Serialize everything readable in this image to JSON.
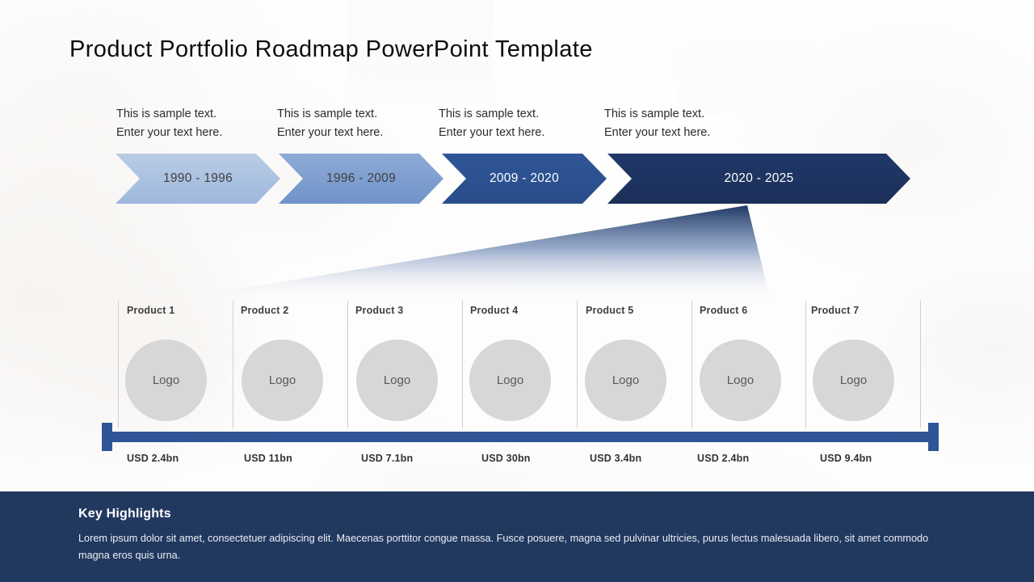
{
  "slide": {
    "title": "Product Portfolio Roadmap PowerPoint Template",
    "background_color": "#ffffff"
  },
  "timeline": {
    "phases": [
      {
        "caption_line1": "This is sample text.",
        "caption_line2": "Enter your text here.",
        "period": "1990 - 1996",
        "fill": "#a8bfdf",
        "text_color": "#3f3f3f"
      },
      {
        "caption_line1": "This is sample text.",
        "caption_line2": "Enter your text here.",
        "period": "1996 - 2009",
        "fill": "#7e9ece",
        "text_color": "#3f3f3f"
      },
      {
        "caption_line1": "This is sample text.",
        "caption_line2": "Enter your text here.",
        "period": "2009 - 2020",
        "fill": "#2e5496",
        "text_color": "#ffffff"
      },
      {
        "caption_line1": "This is sample text.",
        "caption_line2": "Enter your text here.",
        "period": "2020 - 2025",
        "fill": "#1f3864",
        "text_color": "#ffffff"
      }
    ]
  },
  "wedge": {
    "color_top": "#1f3864",
    "color_bottom": "#ffffff"
  },
  "products": {
    "logo_placeholder": "Logo",
    "items": [
      {
        "name": "Product 1",
        "value": "USD 2.4bn"
      },
      {
        "name": "Product 2",
        "value": "USD 11bn"
      },
      {
        "name": "Product 3",
        "value": "USD 7.1bn"
      },
      {
        "name": "Product 4",
        "value": "USD 30bn"
      },
      {
        "name": "Product 5",
        "value": "USD 3.4bn"
      },
      {
        "name": "Product 6",
        "value": "USD 2.4bn"
      },
      {
        "name": "Product 7",
        "value": "USD 9.4bn"
      }
    ],
    "axis_color": "#2f5597"
  },
  "footer": {
    "title": "Key Highlights",
    "body": "Lorem ipsum dolor sit amet, consectetuer adipiscing elit. Maecenas porttitor congue massa. Fusce posuere, magna sed pulvinar ultricies, purus lectus malesuada libero, sit amet commodo  magna eros quis urna.",
    "background_color": "#21385f"
  }
}
